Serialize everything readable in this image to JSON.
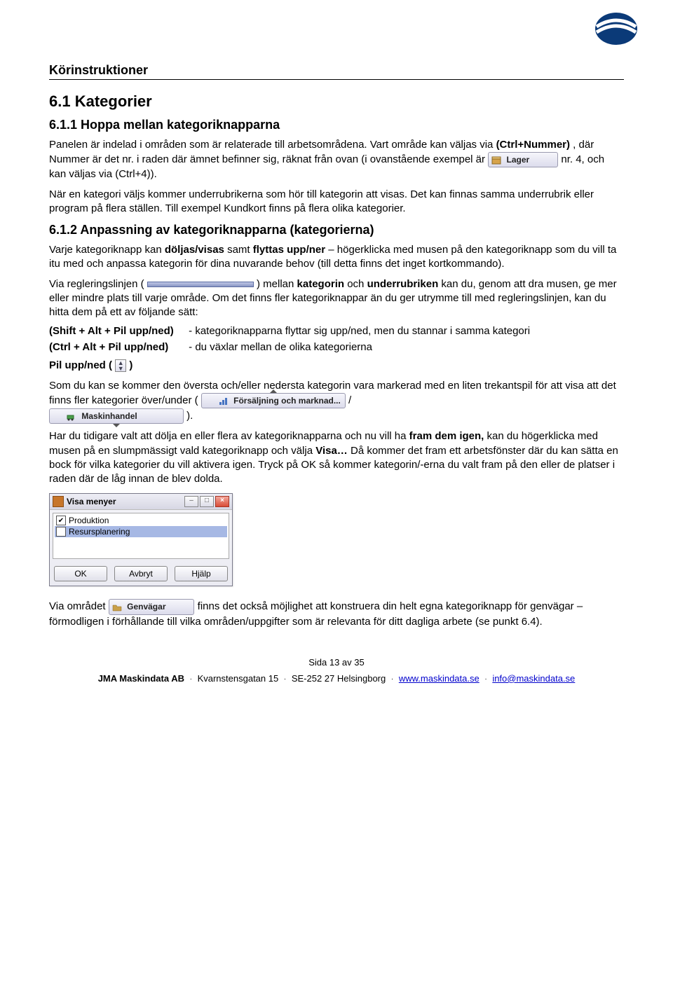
{
  "header": {
    "title": "Körinstruktioner"
  },
  "sec61": {
    "title": "6.1  Kategorier",
    "sub1": {
      "title": "6.1.1  Hoppa mellan kategoriknapparna",
      "p1a": "Panelen är indelad i områden som är relaterade till arbetsområdena. Vart område kan väljas via ",
      "p1b": "(Ctrl+Nummer)",
      "p1c": ", där Nummer är det nr. i raden där ämnet befinner sig, räknat från ovan (i ovanstående exempel är ",
      "lager_btn": "Lager",
      "p1d": " nr. 4, och kan väljas via (Ctrl+4)).",
      "p2": "När en kategori väljs kommer underrubrikerna som hör till kategorin att visas. Det kan finnas samma underrubrik eller program på flera ställen. Till exempel Kundkort finns på flera olika kategorier."
    },
    "sub2": {
      "title": "6.1.2  Anpassning av kategoriknapparna (kategorierna)",
      "p1a": "Varje kategoriknapp kan ",
      "p1b": "döljas/visas",
      "p1c": " samt ",
      "p1d": "flyttas upp/ner",
      "p1e": " – högerklicka med musen på den kategoriknapp som du vill ta itu med och anpassa kategorin för dina nuvarande behov (till detta finns det inget kortkommando).",
      "p2a": "Via regleringslinjen ( ",
      "p2b": " ) mellan ",
      "p2c": "kategorin",
      "p2d": " och ",
      "p2e": "underrubriken",
      "p2f": " kan du, genom att dra musen, ge mer eller mindre plats till varje område. Om det finns fler kategoriknappar än du ger utrymme till med regleringslinjen, kan du hitta dem på ett av följande sätt:",
      "sc1_key": "(Shift + Alt + Pil upp/ned)",
      "sc1_desc": "- kategoriknapparna flyttar sig upp/ned, men du stannar i samma kategori",
      "sc2_key": "(Ctrl + Alt + Pil upp/ned)",
      "sc2_desc": "- du växlar mellan de olika kategorierna",
      "pil_label": "Pil upp/ned (",
      "pil_close": ")",
      "p3a": "Som du kan se kommer den översta och/eller nedersta kategorin vara markerad med en liten trekantspil för att visa att det finns fler kategorier över/under ( ",
      "btn_fors": "Försäljning och marknad...",
      "p3b": " / ",
      "btn_maskin": "Maskinhandel",
      "p3c": " ).",
      "p4a": "Har du tidigare valt att dölja en eller flera av kategoriknapparna och nu vill ha ",
      "p4b": "fram dem igen,",
      "p4c": " kan du högerklicka med musen på en slumpmässigt vald kategoriknapp och välja ",
      "p4d": "Visa…",
      "p4e": " Då kommer det fram ett arbetsfönster där du kan sätta en bock för vilka kategorier du vill aktivera igen. Tryck på OK så kommer kategorin/-erna du valt fram på den eller de platser i raden där de låg innan de blev dolda.",
      "dialog": {
        "title": "Visa menyer",
        "item1": "Produktion",
        "item2": "Resursplanering",
        "ok": "OK",
        "cancel": "Avbryt",
        "help": "Hjälp"
      },
      "p5a": "Via området ",
      "btn_genv": "Genvägar",
      "p5b": " finns det också möjlighet att konstruera din helt egna kategoriknapp för genvägar – förmodligen i förhållande till vilka områden/uppgifter som är relevanta för ditt dagliga arbete (se punkt 6.4)."
    }
  },
  "footer": {
    "page": "Sida 13 av 35",
    "company": "JMA Maskindata AB",
    "addr1": "Kvarnstensgatan 15",
    "addr2": "SE-252 27 Helsingborg",
    "web": "www.maskindata.se",
    "email": "info@maskindata.se"
  }
}
